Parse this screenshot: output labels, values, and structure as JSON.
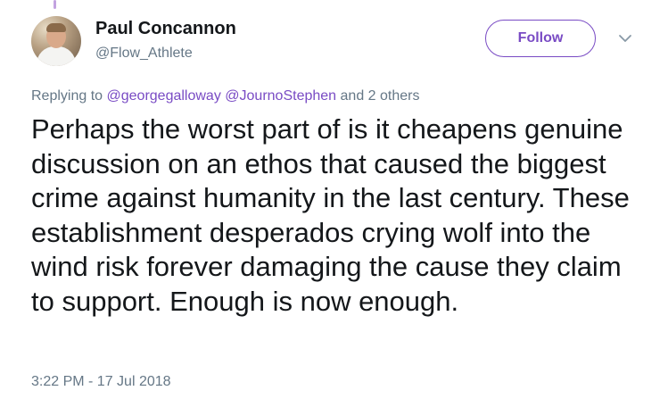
{
  "author": {
    "display_name": "Paul Concannon",
    "handle": "@Flow_Athlete"
  },
  "header": {
    "follow_label": "Follow",
    "menu_icon": "chevron-down-icon"
  },
  "reply": {
    "prefix": "Replying to",
    "mention_1": "@georgegalloway",
    "mention_2": "@JournoStephen",
    "suffix": "and 2 others"
  },
  "tweet": {
    "text": "Perhaps the worst part of is it cheapens genuine discussion on an ethos that caused the biggest crime against humanity in the last century. These establishment desperados crying wolf into the wind risk forever damaging the cause they claim to support. Enough is now enough.",
    "timestamp": "3:22 PM - 17 Jul 2018"
  },
  "colors": {
    "accent": "#794bc4",
    "text": "#14171a",
    "secondary_text": "#657786"
  }
}
